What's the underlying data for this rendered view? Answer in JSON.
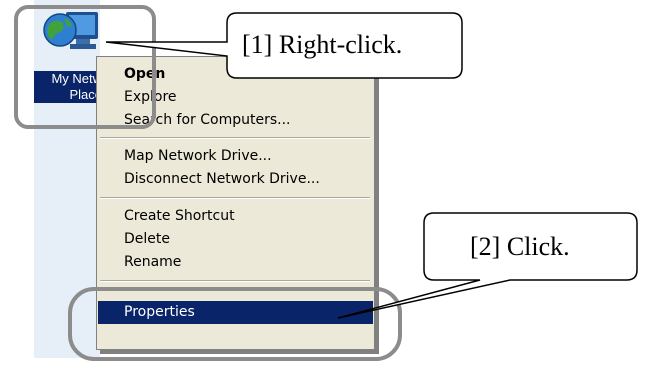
{
  "desktop": {
    "icon_name": "network-computer-icon",
    "label_line1": "My Netw",
    "label_line2": "Place",
    "selection_color": "#0a246a"
  },
  "context_menu": {
    "items": [
      {
        "label": "Open",
        "bold": true
      },
      {
        "label": "Explore"
      },
      {
        "label": "Search for Computers..."
      },
      {
        "label": "Map Network Drive..."
      },
      {
        "label": "Disconnect Network Drive..."
      },
      {
        "label": "Create Shortcut"
      },
      {
        "label": "Delete"
      },
      {
        "label": "Rename"
      },
      {
        "label": "Properties",
        "selected": true
      }
    ],
    "background": "#ece9d8",
    "highlight": "#0a246a"
  },
  "callouts": {
    "step1": "[1] Right-click.",
    "step2": "[2] Click."
  }
}
